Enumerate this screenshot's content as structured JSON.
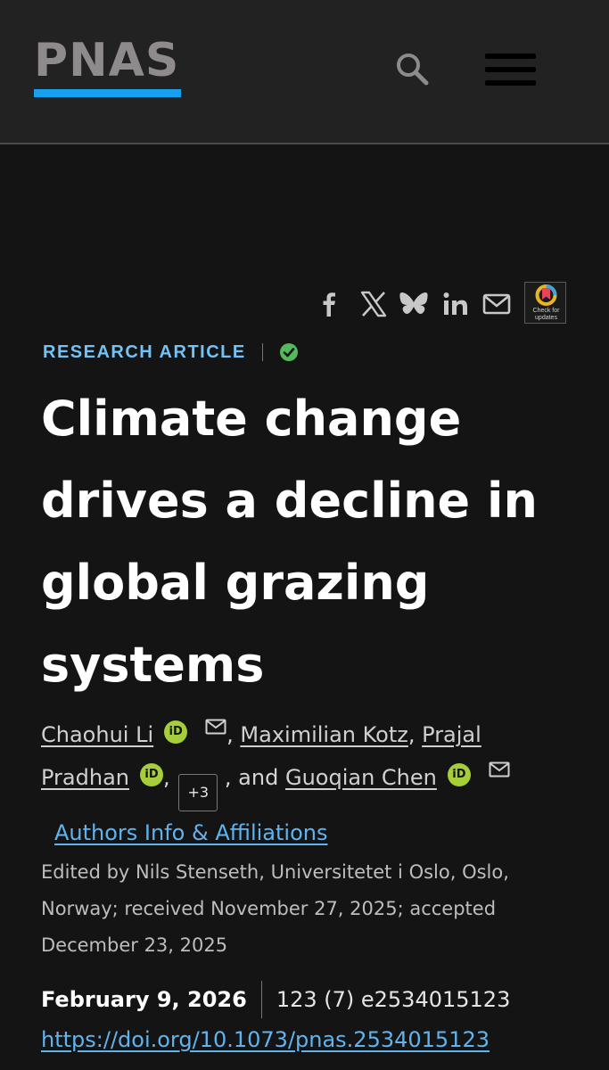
{
  "header": {
    "logo_text": "PNAS",
    "logo_color": "#8f8a8c",
    "logo_accent": "#18a0f0",
    "search_icon": "search-icon",
    "menu_icon": "hamburger-menu-icon"
  },
  "share": {
    "icons": [
      "facebook-icon",
      "x-twitter-icon",
      "bluesky-icon",
      "linkedin-icon",
      "email-icon"
    ],
    "crossmark_label": "Check for updates"
  },
  "article": {
    "type_label": "RESEARCH ARTICLE",
    "type_color": "#74c2f5",
    "open_access_badge": "check-badge-icon",
    "title": "Climate change drives a decline in global grazing systems"
  },
  "authors": {
    "list": [
      {
        "name": "Chaohui Li"
      },
      {
        "name": "Maximilian Kotz"
      },
      {
        "name": "Prajal Pradhan"
      },
      {
        "name": "Guoqian Chen"
      }
    ],
    "separator_comma": ",",
    "more_label": "+3",
    "and_label": ", and",
    "orcid_label": "iD",
    "affiliations_link": "Authors Info & Affiliations"
  },
  "edited_text": "Edited by Nils Stenseth, Universitetet i Oslo, Oslo, Norway; received November 27, 2025; accepted December 23, 2025",
  "publication": {
    "date": "February 9, 2026",
    "volume_info": "123 (7) e2534015123",
    "doi": "https://doi.org/10.1073/pnas.2534015123"
  }
}
